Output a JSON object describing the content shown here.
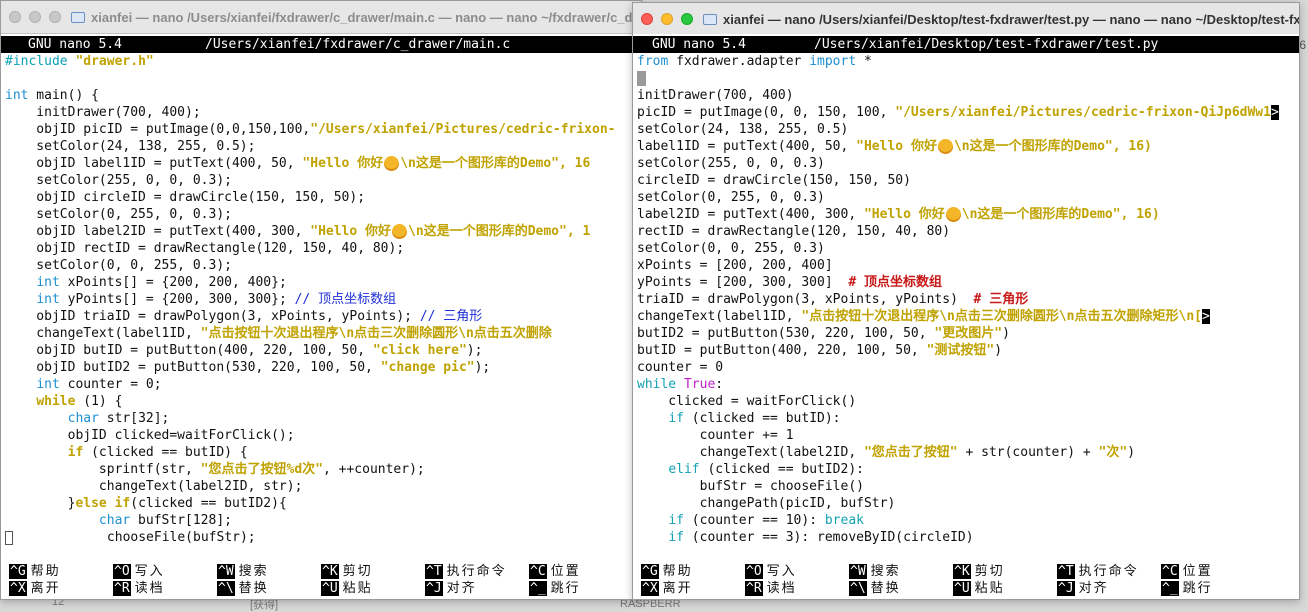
{
  "background": {
    "left_num": "12",
    "left_tag": "[获得]",
    "right_snip": "RASPBERR",
    "edge_glyph": "6"
  },
  "left_window": {
    "title": "xianfei — nano /Users/xianfei/fxdrawer/c_drawer/main.c — nano — nano ~/fxdrawer/c_drawer",
    "nano_version": "GNU nano 5.4",
    "file_path": "/Users/xianfei/fxdrawer/c_drawer/main.c"
  },
  "right_window": {
    "title": "xianfei — nano /Users/xianfei/Desktop/test-fxdrawer/test.py — nano — nano ~/Desktop/test-fxdrawer",
    "nano_version": "GNU nano 5.4",
    "file_path": "/Users/xianfei/Desktop/test-fxdrawer/test.py"
  },
  "left_code": [
    "#include \"drawer.h\"",
    "",
    "int main() {",
    "    initDrawer(700, 400);",
    "    objID picID = putImage(0,0,150,100,\"/Users/xianfei/Pictures/cedric-frixon-",
    "    setColor(24, 138, 255, 0.5);",
    "    objID label1ID = putText(400, 50, \"Hello 你好",
    "    setColor(255, 0, 0, 0.3);",
    "    objID circleID = drawCircle(150, 150, 50);",
    "    setColor(0, 255, 0, 0.3);",
    "    objID label2ID = putText(400, 300, \"Hello 你好",
    "    objID rectID = drawRectangle(120, 150, 40, 80);",
    "    setColor(0, 0, 255, 0.3);",
    "    int xPoints[] = {200, 200, 400};",
    "    int yPoints[] = {200, 300, 300}; // 顶点坐标数组",
    "    objID triaID = drawPolygon(3, xPoints, yPoints); // 三角形",
    "    changeText(label1ID, \"点击按钮十次退出程序\\n点击三次删除圆形\\n点击五次删除",
    "    objID butID = putButton(400, 220, 100, 50, \"click here\");",
    "    objID butID2 = putButton(530, 220, 100, 50, \"change pic\");",
    "    int counter = 0;",
    "    while (1) {",
    "        char str[32];",
    "        objID clicked=waitForClick();",
    "        if (clicked == butID) {",
    "            sprintf(str, \"您点击了按钮%d次\", ++counter);",
    "            changeText(label2ID, str);",
    "        }else if(clicked == butID2){",
    "            char bufStr[128];",
    "            chooseFile(bufStr);"
  ],
  "left_code_tails": {
    "label1": "\\n这是一个图形库的Demo\", 16",
    "label2": "\\n这是一个图形库的Demo\", 1"
  },
  "right_code": [
    "from fxdrawer.adapter import *",
    "",
    "initDrawer(700, 400)",
    "picID = putImage(0, 0, 150, 100, \"/Users/xianfei/Pictures/cedric-frixon-QiJp6dWw1",
    "setColor(24, 138, 255, 0.5)",
    "label1ID = putText(400, 50, \"Hello 你好",
    "setColor(255, 0, 0, 0.3)",
    "circleID = drawCircle(150, 150, 50)",
    "setColor(0, 255, 0, 0.3)",
    "label2ID = putText(400, 300, \"Hello 你好",
    "rectID = drawRectangle(120, 150, 40, 80)",
    "setColor(0, 0, 255, 0.3)",
    "xPoints = [200, 200, 400]",
    "yPoints = [200, 300, 300]  # 顶点坐标数组",
    "triaID = drawPolygon(3, xPoints, yPoints)  # 三角形",
    "changeText(label1ID, \"点击按钮十次退出程序\\n点击三次删除圆形\\n点击五次删除矩形\\n[",
    "butID2 = putButton(530, 220, 100, 50, \"更改图片\")",
    "butID = putButton(400, 220, 100, 50, \"测试按钮\")",
    "counter = 0",
    "while True:",
    "    clicked = waitForClick()",
    "    if (clicked == butID):",
    "        counter += 1",
    "        changeText(label2ID, \"您点击了按钮\" + str(counter) + \"次\")",
    "    elif (clicked == butID2):",
    "        bufStr = chooseFile()",
    "        changePath(picID, bufStr)",
    "    if (counter == 10): break",
    "    if (counter == 3): removeByID(circleID)"
  ],
  "right_code_tails": {
    "label1": "\\n这是一个图形库的Demo\", 16)",
    "label2": "\\n这是一个图形库的Demo\", 16)"
  },
  "truncation_marker": ">",
  "shortcuts": [
    {
      "key": "^G",
      "label": "帮助"
    },
    {
      "key": "^O",
      "label": "写入"
    },
    {
      "key": "^W",
      "label": "搜索"
    },
    {
      "key": "^K",
      "label": "剪切"
    },
    {
      "key": "^T",
      "label": "执行命令"
    },
    {
      "key": "^C",
      "label": "位置"
    },
    {
      "key": "^X",
      "label": "离开"
    },
    {
      "key": "^R",
      "label": "读档"
    },
    {
      "key": "^\\",
      "label": "替换"
    },
    {
      "key": "^U",
      "label": "粘贴"
    },
    {
      "key": "^J",
      "label": "对齐"
    },
    {
      "key": "^_",
      "label": "跳行"
    }
  ],
  "colors": {
    "type_keyword": "#1e8fd0",
    "string": "#c0a200",
    "preprocessor": "#0aa3b8",
    "c_comment": "#1f2ed6",
    "py_comment": "#c81818",
    "py_true": "#c021c9"
  }
}
